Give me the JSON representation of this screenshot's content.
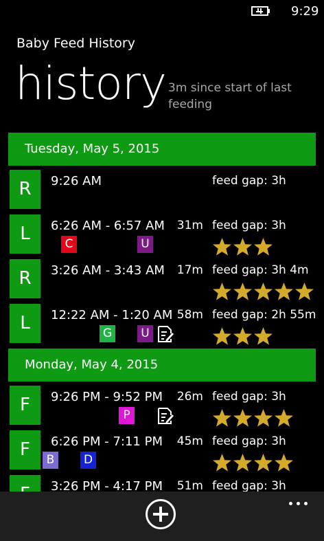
{
  "status": {
    "time": "9:29"
  },
  "header": {
    "app_title": "Baby Feed History",
    "page_title": "history",
    "since_text": "3m since start of last feeding"
  },
  "colors": {
    "accent": "#0e9a12",
    "star": "#d4aa2a",
    "tag_C": "#e3061a",
    "tag_U": "#7d1b86",
    "tag_G": "#1fb443",
    "tag_P": "#e016d6",
    "tag_B": "#7c6bd0",
    "tag_D": "#1424d4"
  },
  "days": [
    {
      "label": "Tuesday, May 5, 2015",
      "entries": [
        {
          "side": "R",
          "time": "9:26 AM",
          "duration": "",
          "gap": "feed gap: 3h",
          "stars": 0,
          "tags": [],
          "note": false
        },
        {
          "side": "L",
          "time": "6:26 AM - 6:57 AM",
          "duration": "31m",
          "gap": "feed gap: 3h",
          "stars": 3,
          "tags": [
            "C",
            "U"
          ],
          "note": false
        },
        {
          "side": "R",
          "time": "3:26 AM - 3:43 AM",
          "duration": "17m",
          "gap": "feed gap: 3h 4m",
          "stars": 5,
          "tags": [],
          "note": false
        },
        {
          "side": "L",
          "time": "12:22 AM - 1:20 AM",
          "duration": "58m",
          "gap": "feed gap: 2h 55m",
          "stars": 3,
          "tags": [
            "G",
            "U"
          ],
          "note": true
        }
      ]
    },
    {
      "label": "Monday, May 4, 2015",
      "entries": [
        {
          "side": "F",
          "time": "9:26 PM - 9:52 PM",
          "duration": "26m",
          "gap": "feed gap: 3h",
          "stars": 4,
          "tags": [
            "P"
          ],
          "note": true
        },
        {
          "side": "F",
          "time": "6:26 PM - 7:11 PM",
          "duration": "45m",
          "gap": "feed gap: 3h",
          "stars": 4,
          "tags": [
            "B",
            "D"
          ],
          "note": false
        },
        {
          "side": "F",
          "time": "3:26 PM - 4:17 PM",
          "duration": "51m",
          "gap": "feed gap: 3h",
          "stars": 0,
          "tags": [],
          "note": false
        }
      ]
    }
  ],
  "appbar": {
    "add_icon": "add-circle-icon",
    "more_icon": "more-dots-icon"
  }
}
